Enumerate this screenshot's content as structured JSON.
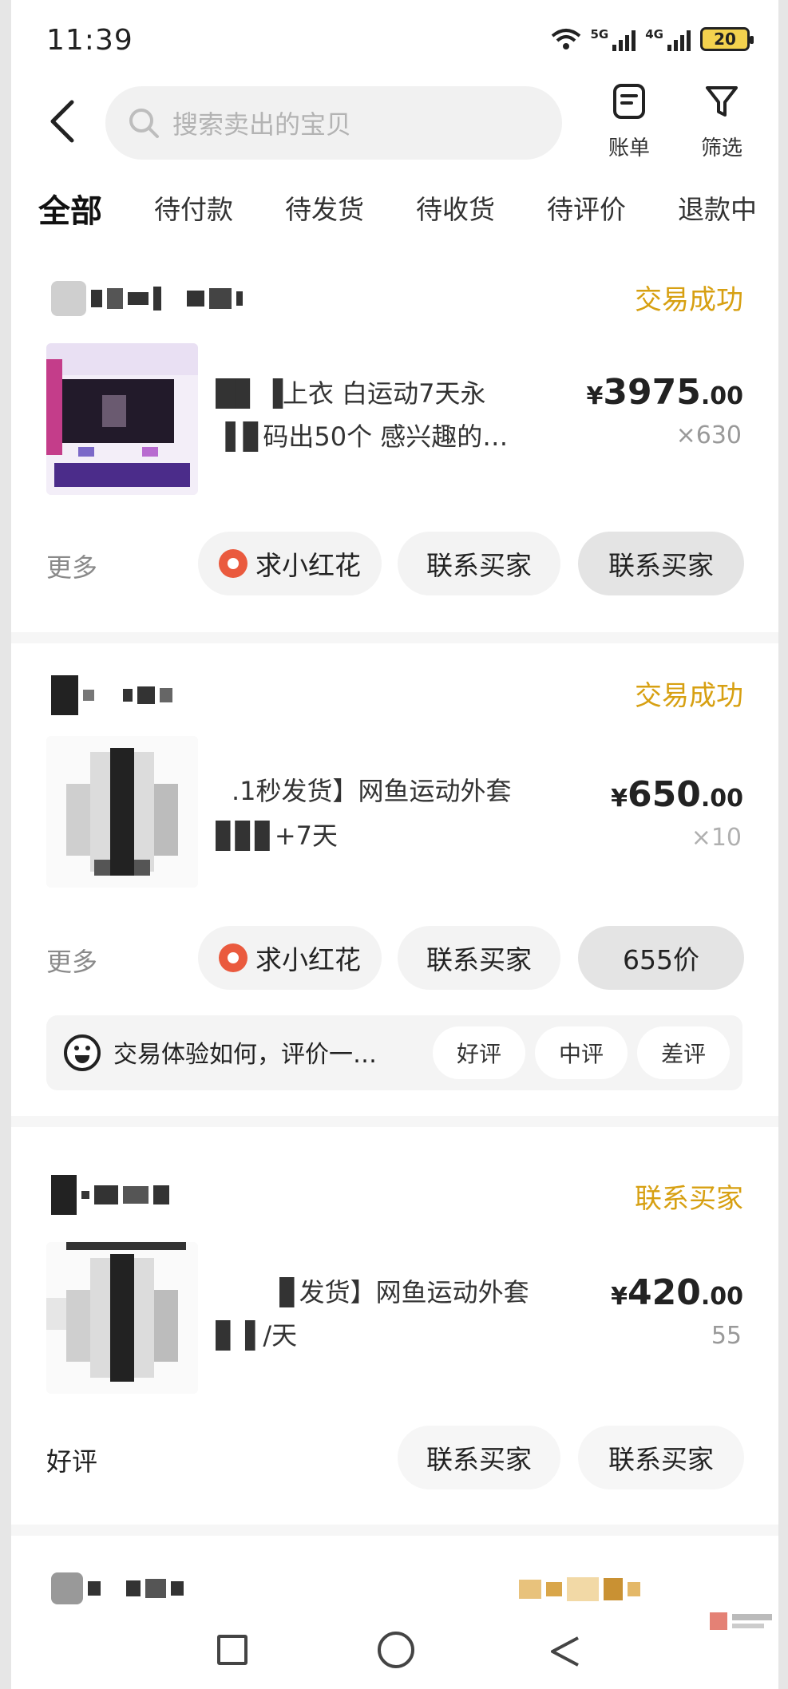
{
  "status_bar": {
    "time": "11:39",
    "net1": "5G",
    "net2": "4G",
    "battery": "20"
  },
  "header": {
    "search_placeholder": "搜索卖出的宝贝",
    "bill_label": "账单",
    "filter_label": "筛选"
  },
  "tabs": [
    "全部",
    "待付款",
    "待发货",
    "待收货",
    "待评价",
    "退款中"
  ],
  "orders": [
    {
      "status": "交易成功",
      "title_line1": "█▊ ▐上衣 白运动7天永",
      "title_line2": "▐ ▊码出50个 感兴趣的…",
      "currency": "¥",
      "price_int": "3975",
      "price_dec": ".00",
      "qty": "×630",
      "more": "更多",
      "btn1": "求小红花",
      "btn2": "联系买家",
      "btn3": "联系买家"
    },
    {
      "status": "交易成功",
      "title_line1": ".1秒发货】网鱼运动外套",
      "title_line2": "▊▊▊+7天",
      "currency": "¥",
      "price_int": "650",
      "price_dec": ".00",
      "qty": "×10",
      "more": "更多",
      "btn1": "求小红花",
      "btn2": "联系买家",
      "btn3": "655价",
      "rating_question": "交易体验如何，评价一…",
      "rating_options": [
        "好评",
        "中评",
        "差评"
      ]
    },
    {
      "status": "联系买家",
      "title_line1": "▊发货】网鱼运动外套",
      "title_line2": "▊▐ /天",
      "currency": "¥",
      "price_int": "420",
      "price_dec": ".00",
      "qty": "55",
      "more": "好评",
      "btn2": "联系买家",
      "btn3": "联系买家"
    }
  ],
  "colors": {
    "accent": "#d7a012",
    "tab_highlight": "#ffe24a",
    "flower": "#ea5a3e"
  }
}
